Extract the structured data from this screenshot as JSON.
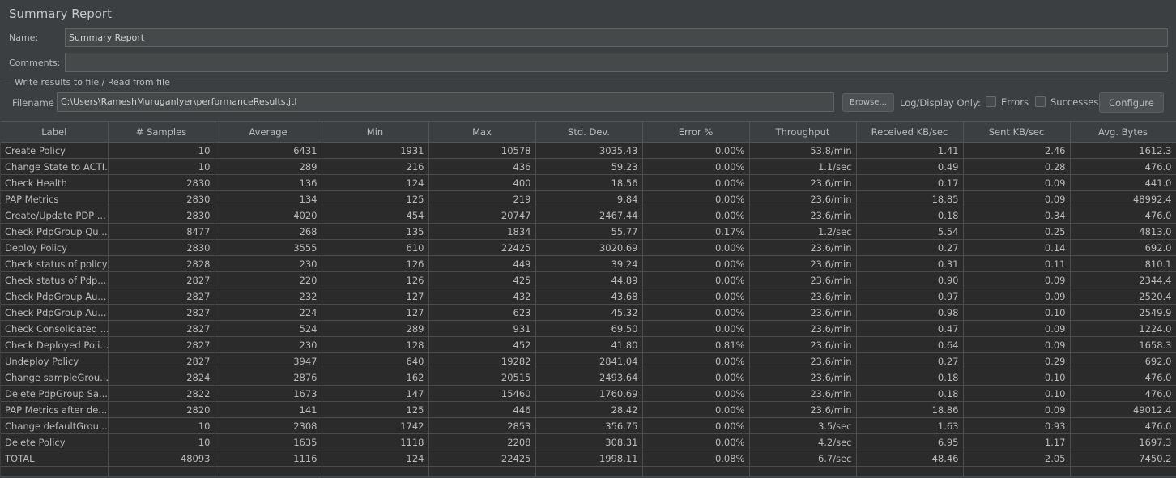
{
  "title": "Summary Report",
  "form": {
    "name_label": "Name:",
    "name_value": "Summary Report",
    "comments_label": "Comments:",
    "comments_value": "",
    "group_title": "Write results to file / Read from file",
    "filename_label": "Filename",
    "filename_value": "C:\\Users\\RameshMuruganIyer\\performanceResults.jtl",
    "browse_label": "Browse...",
    "log_display_label": "Log/Display Only:",
    "errors_label": "Errors",
    "successes_label": "Successes",
    "configure_label": "Configure"
  },
  "table": {
    "columns": [
      "Label",
      "# Samples",
      "Average",
      "Min",
      "Max",
      "Std. Dev.",
      "Error %",
      "Throughput",
      "Received KB/sec",
      "Sent KB/sec",
      "Avg. Bytes"
    ],
    "rows": [
      [
        "Create Policy",
        "10",
        "6431",
        "1931",
        "10578",
        "3035.43",
        "0.00%",
        "53.8/min",
        "1.41",
        "2.46",
        "1612.3"
      ],
      [
        "Change State to ACTI...",
        "10",
        "289",
        "216",
        "436",
        "59.23",
        "0.00%",
        "1.1/sec",
        "0.49",
        "0.28",
        "476.0"
      ],
      [
        "Check Health",
        "2830",
        "136",
        "124",
        "400",
        "18.56",
        "0.00%",
        "23.6/min",
        "0.17",
        "0.09",
        "441.0"
      ],
      [
        "PAP Metrics",
        "2830",
        "134",
        "125",
        "219",
        "9.84",
        "0.00%",
        "23.6/min",
        "18.85",
        "0.09",
        "48992.4"
      ],
      [
        "Create/Update PDP ...",
        "2830",
        "4020",
        "454",
        "20747",
        "2467.44",
        "0.00%",
        "23.6/min",
        "0.18",
        "0.34",
        "476.0"
      ],
      [
        "Check PdpGroup Qu...",
        "8477",
        "268",
        "135",
        "1834",
        "55.77",
        "0.17%",
        "1.2/sec",
        "5.54",
        "0.25",
        "4813.0"
      ],
      [
        "Deploy Policy",
        "2830",
        "3555",
        "610",
        "22425",
        "3020.69",
        "0.00%",
        "23.6/min",
        "0.27",
        "0.14",
        "692.0"
      ],
      [
        "Check status of policy",
        "2828",
        "230",
        "126",
        "449",
        "39.24",
        "0.00%",
        "23.6/min",
        "0.31",
        "0.11",
        "810.1"
      ],
      [
        "Check status of Pdp...",
        "2827",
        "220",
        "126",
        "425",
        "44.89",
        "0.00%",
        "23.6/min",
        "0.90",
        "0.09",
        "2344.4"
      ],
      [
        "Check PdpGroup Au...",
        "2827",
        "232",
        "127",
        "432",
        "43.68",
        "0.00%",
        "23.6/min",
        "0.97",
        "0.09",
        "2520.4"
      ],
      [
        "Check PdpGroup Au...",
        "2827",
        "224",
        "127",
        "623",
        "45.32",
        "0.00%",
        "23.6/min",
        "0.98",
        "0.10",
        "2549.9"
      ],
      [
        "Check Consolidated ...",
        "2827",
        "524",
        "289",
        "931",
        "69.50",
        "0.00%",
        "23.6/min",
        "0.47",
        "0.09",
        "1224.0"
      ],
      [
        "Check Deployed Poli...",
        "2827",
        "230",
        "128",
        "452",
        "41.80",
        "0.81%",
        "23.6/min",
        "0.64",
        "0.09",
        "1658.3"
      ],
      [
        "Undeploy Policy",
        "2827",
        "3947",
        "640",
        "19282",
        "2841.04",
        "0.00%",
        "23.6/min",
        "0.27",
        "0.29",
        "692.0"
      ],
      [
        "Change sampleGrou...",
        "2824",
        "2876",
        "162",
        "20515",
        "2493.64",
        "0.00%",
        "23.6/min",
        "0.18",
        "0.10",
        "476.0"
      ],
      [
        "Delete PdpGroup Sa...",
        "2822",
        "1673",
        "147",
        "15460",
        "1760.69",
        "0.00%",
        "23.6/min",
        "0.18",
        "0.10",
        "476.0"
      ],
      [
        "PAP Metrics after de...",
        "2820",
        "141",
        "125",
        "446",
        "28.42",
        "0.00%",
        "23.6/min",
        "18.86",
        "0.09",
        "49012.4"
      ],
      [
        "Change defaultGrou...",
        "10",
        "2308",
        "1742",
        "2853",
        "356.75",
        "0.00%",
        "3.5/sec",
        "1.63",
        "0.93",
        "476.0"
      ],
      [
        "Delete Policy",
        "10",
        "1635",
        "1118",
        "2208",
        "308.31",
        "0.00%",
        "4.2/sec",
        "6.95",
        "1.17",
        "1697.3"
      ],
      [
        "TOTAL",
        "48093",
        "1116",
        "124",
        "22425",
        "1998.11",
        "0.08%",
        "6.7/sec",
        "48.46",
        "2.05",
        "7450.2"
      ]
    ]
  }
}
